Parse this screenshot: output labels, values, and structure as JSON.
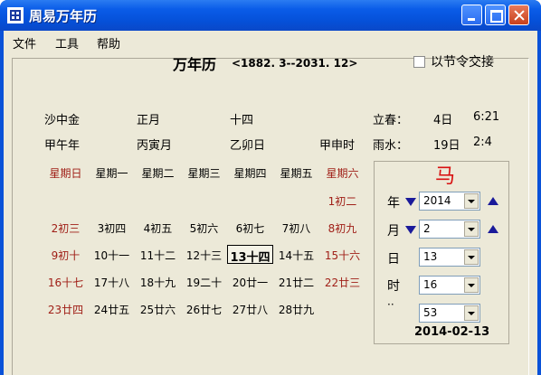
{
  "window": {
    "title": "周易万年历"
  },
  "menu": {
    "items": [
      "文件",
      "工具",
      "帮助"
    ]
  },
  "header": {
    "title": "万年历",
    "range": "<1882. 3--2031. 12>",
    "checkbox_label": "以节令交接",
    "checkbox_checked": false
  },
  "ganzhi": {
    "year_nayin": "沙中金",
    "month_name": "正月",
    "day_name": "十四",
    "year_gz": "甲午年",
    "month_gz": "丙寅月",
    "day_gz": "乙卯日",
    "hour_gz": "甲申时"
  },
  "solar_terms": [
    {
      "name": "立春：",
      "day": "4日",
      "time": "6:21"
    },
    {
      "name": "雨水：",
      "day": "19日",
      "time": "2:4"
    }
  ],
  "weekdays": [
    "星期日",
    "星期一",
    "星期二",
    "星期三",
    "星期四",
    "星期五",
    "星期六"
  ],
  "calendar": {
    "rows": [
      [
        "",
        "",
        "",
        "",
        "",
        "",
        "1初二"
      ],
      [
        "2初三",
        "3初四",
        "4初五",
        "5初六",
        "6初七",
        "7初八",
        "8初九"
      ],
      [
        "9初十",
        "10十一",
        "11十二",
        "12十三",
        "13十四",
        "14十五",
        "15十六"
      ],
      [
        "16十七",
        "17十八",
        "18十九",
        "19二十",
        "20廿一",
        "21廿二",
        "22廿三"
      ],
      [
        "23廿四",
        "24廿五",
        "25廿六",
        "26廿七",
        "27廿八",
        "28廿九",
        ""
      ]
    ],
    "selected_day": "13十四"
  },
  "controls": {
    "zodiac": "马",
    "year_label": "年",
    "year_value": "2014",
    "month_label": "月",
    "month_value": "2",
    "day_label": "日",
    "day_value": "13",
    "hour_label": "时",
    "hour_value": "16",
    "minute_label": "··",
    "minute_value": "53",
    "date_display": "2014-02-13"
  },
  "colors": {
    "weekend_red": "#a02018",
    "zodiac_red": "#d81010",
    "arrow_blue": "#1a1a9a"
  }
}
